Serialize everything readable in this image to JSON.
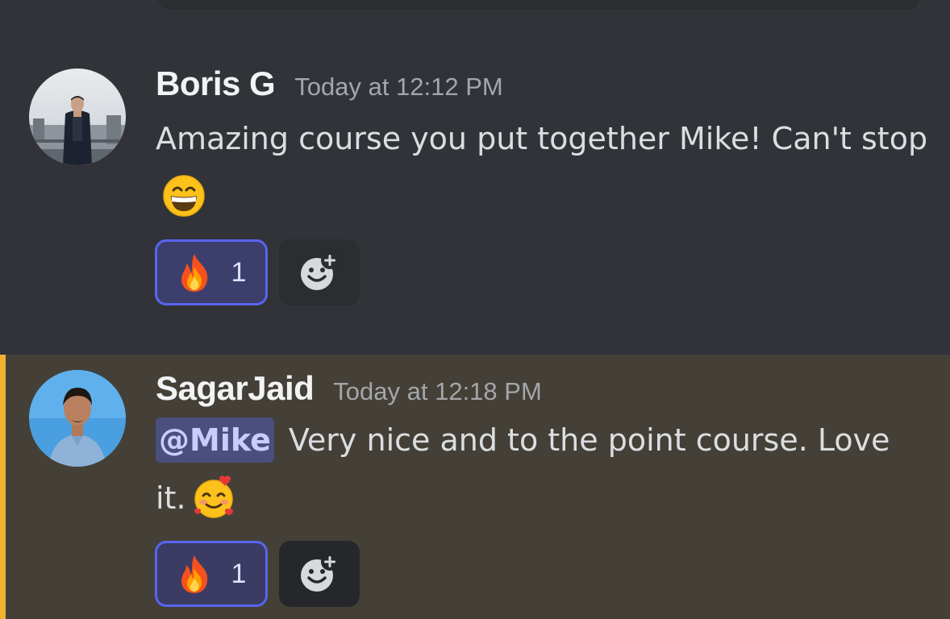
{
  "messages": [
    {
      "username": "Boris G",
      "timestamp": "Today at 12:12 PM",
      "text": "Amazing course you put together Mike! Can't stop",
      "emoji": "grinning-face-with-smiling-eyes",
      "reaction": {
        "emoji": "fire",
        "count": "1"
      }
    },
    {
      "username": "SagarJaid",
      "timestamp": "Today at 12:18 PM",
      "mention": "@Mike",
      "text": "Very nice and to the point course. Love it.",
      "emoji": "smiling-face-with-hearts",
      "reaction": {
        "emoji": "fire",
        "count": "1"
      }
    }
  ],
  "colors": {
    "background": "#313338",
    "highlight_background": "#444037",
    "mention_bar": "#f0b232",
    "reaction_border": "#5865f2",
    "mention_text": "#c9cdfb"
  }
}
